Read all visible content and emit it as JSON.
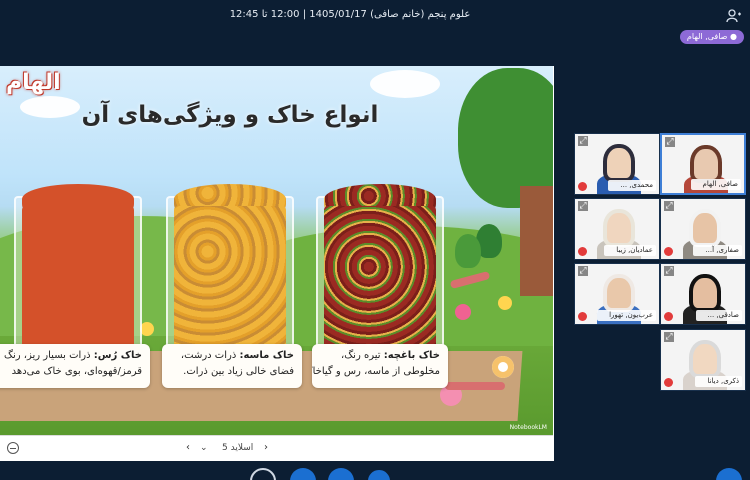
{
  "header": {
    "class_title": "علوم پنجم (خانم صافی) 1405/01/17 | 12:00 تا 12:45"
  },
  "presenter": {
    "name": "صافی, الهام"
  },
  "slide": {
    "brand": "الهام",
    "title": "انواع خاک و ویژگی‌های آن",
    "captions": [
      {
        "head": "خاک باغچه:",
        "line1": " تیره رنگ،",
        "line2": "مخلوطی از ماسه، رس و گیاخاک."
      },
      {
        "head": "خاک ماسه:",
        "line1": " ذرات درشت،",
        "line2": "فضای خالی زیاد بین ذرات."
      },
      {
        "head": "خاک رُس:",
        "line1": " ذرات بسیار ریز، رنگ",
        "line2": "قرمز/قهوه‌ای، بوی خاک می‌دهد"
      }
    ],
    "watermark": "NotebookLM"
  },
  "slide_nav": {
    "slide_label": "اسلاید 5",
    "prev_icon": "chevron-left-icon",
    "next_icon": "chevron-right-icon"
  },
  "webcams": [
    {
      "name": "صافی, الهام",
      "active": true,
      "mic_off": false
    },
    {
      "name": "محمدی, ...",
      "active": false,
      "mic_off": true
    },
    {
      "name": "صفاری, آ...",
      "active": false,
      "mic_off": true
    },
    {
      "name": "عمادیان, زیبا",
      "active": false,
      "mic_off": true
    },
    {
      "name": "صادقی, ...",
      "active": false,
      "mic_off": true
    },
    {
      "name": "عرب‌یون, تهورا",
      "active": false,
      "mic_off": true
    },
    {
      "name": "ذکری, دیانا",
      "active": false,
      "mic_off": true
    }
  ],
  "colors": {
    "background": "#0c1e33",
    "presenter_chip": "#8d6ad6",
    "active_cam_border": "#3e7fd6",
    "mic_off": "#e23b3b"
  }
}
